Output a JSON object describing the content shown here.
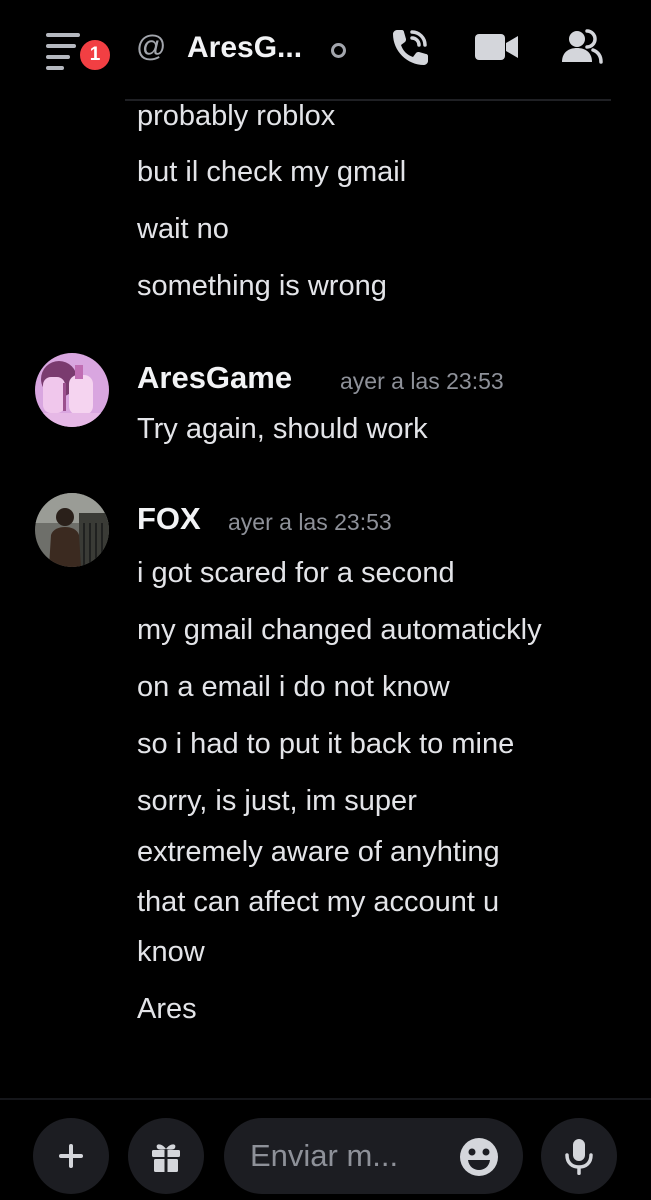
{
  "header": {
    "notification_count": "1",
    "at_symbol": "@",
    "channel_title": "AresG...",
    "icons": [
      "menu-icon",
      "at-icon",
      "status-dot-icon",
      "voice-call-icon",
      "video-call-icon",
      "members-icon"
    ]
  },
  "messages": {
    "continuation_lines": [
      "probably roblox",
      "but il check my gmail",
      "wait no",
      "something is wrong"
    ],
    "groups": [
      {
        "author": "AresGame",
        "timestamp": "ayer a las 23:53",
        "lines": [
          "Try again, should work"
        ]
      },
      {
        "author": "FOX",
        "timestamp": "ayer a las 23:53",
        "lines": [
          "i got scared for a second",
          "my gmail changed automatickly",
          "on a email i do not know",
          "so i had to put it back to mine",
          "sorry, is just, im super",
          "extremely aware of anyhting",
          "that can affect my account u",
          "know",
          "Ares"
        ]
      }
    ]
  },
  "composer": {
    "placeholder": "Enviar m...",
    "icons": [
      "plus-icon",
      "gift-icon",
      "emoji-icon",
      "microphone-icon"
    ]
  },
  "colors": {
    "background": "#000000",
    "badge": "#f23f43",
    "text": "#e3e4e8",
    "muted": "#8e9199",
    "input_bg": "#1c1d22"
  }
}
